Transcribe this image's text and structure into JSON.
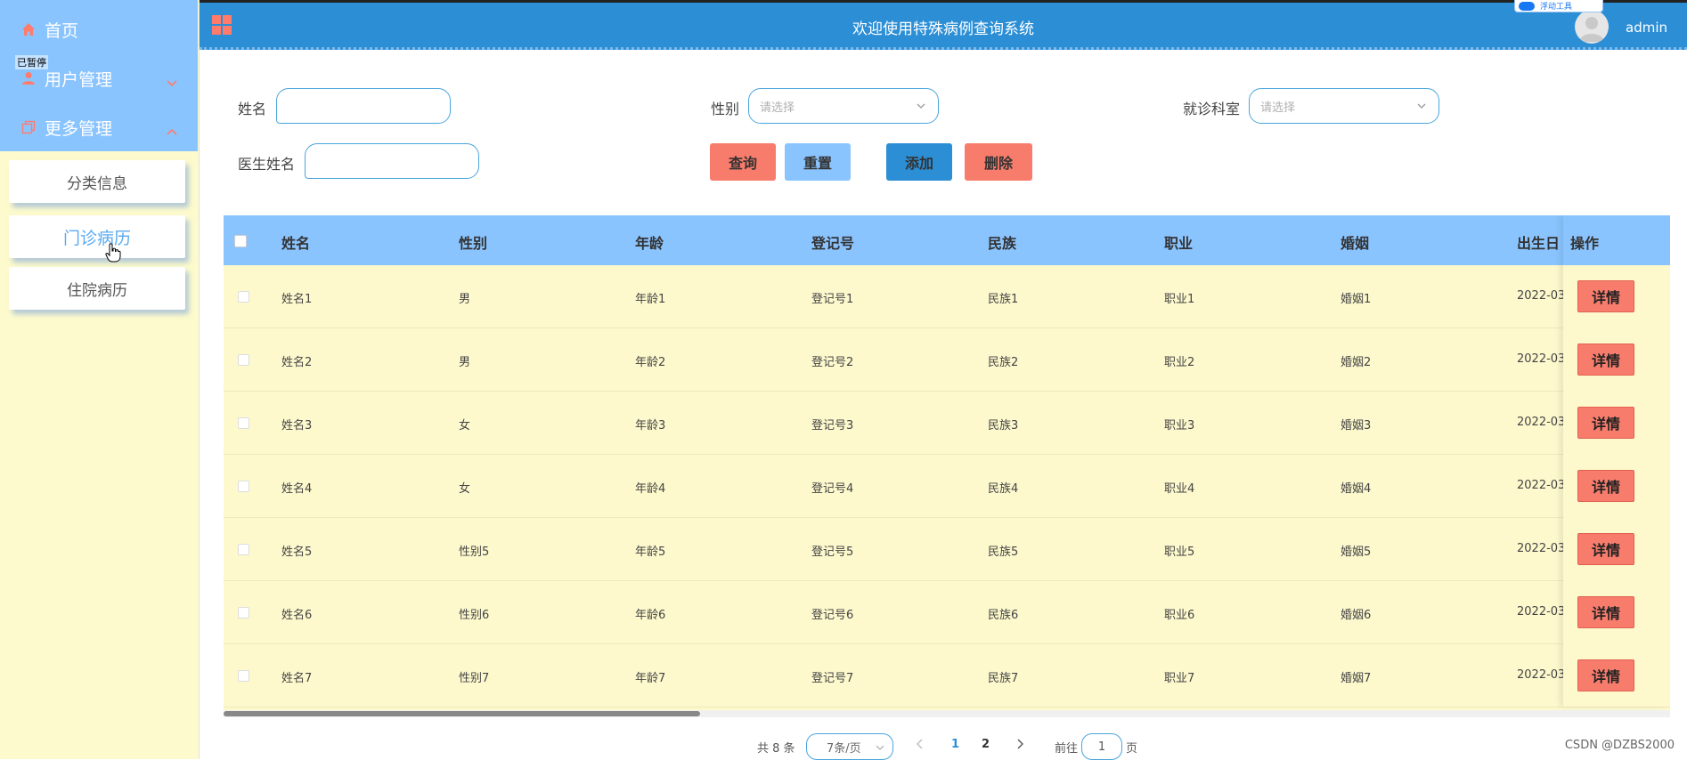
{
  "sidebar": {
    "items": [
      {
        "label": "首页",
        "icon": "home-icon"
      },
      {
        "label": "用户管理",
        "icon": "user-icon"
      },
      {
        "label": "更多管理",
        "icon": "copy-icon"
      }
    ],
    "paused_label": "已暂停",
    "sub_items": [
      {
        "label": "分类信息"
      },
      {
        "label": "门诊病历"
      },
      {
        "label": "住院病历"
      }
    ]
  },
  "header": {
    "title": "欢迎使用特殊病例查询系统",
    "user": "admin",
    "corner_badge": "浮动工具"
  },
  "search": {
    "name_label": "姓名",
    "name_value": "",
    "gender_label": "性别",
    "gender_placeholder": "请选择",
    "dept_label": "就诊科室",
    "dept_placeholder": "请选择",
    "doctor_label": "医生姓名",
    "doctor_value": "",
    "buttons": {
      "query": "查询",
      "reset": "重置",
      "add": "添加",
      "delete": "删除"
    }
  },
  "table": {
    "columns": [
      "姓名",
      "性别",
      "年龄",
      "登记号",
      "民族",
      "职业",
      "婚姻",
      "出生日",
      "操作"
    ],
    "rows": [
      [
        "姓名1",
        "男",
        "年龄1",
        "登记号1",
        "民族1",
        "职业1",
        "婚姻1",
        "2022-03-"
      ],
      [
        "姓名2",
        "男",
        "年龄2",
        "登记号2",
        "民族2",
        "职业2",
        "婚姻2",
        "2022-03-"
      ],
      [
        "姓名3",
        "女",
        "年龄3",
        "登记号3",
        "民族3",
        "职业3",
        "婚姻3",
        "2022-03-"
      ],
      [
        "姓名4",
        "女",
        "年龄4",
        "登记号4",
        "民族4",
        "职业4",
        "婚姻4",
        "2022-03-"
      ],
      [
        "姓名5",
        "性别5",
        "年龄5",
        "登记号5",
        "民族5",
        "职业5",
        "婚姻5",
        "2022-03-"
      ],
      [
        "姓名6",
        "性别6",
        "年龄6",
        "登记号6",
        "民族6",
        "职业6",
        "婚姻6",
        "2022-03-"
      ],
      [
        "姓名7",
        "性别7",
        "年龄7",
        "登记号7",
        "民族7",
        "职业7",
        "婚姻7",
        "2022-03-"
      ]
    ],
    "detail_label": "详情"
  },
  "pagination": {
    "total": "共 8 条",
    "page_size": "7条/页",
    "pages": [
      "1",
      "2"
    ],
    "current": "1",
    "goto_prefix": "前往",
    "goto_value": "1",
    "goto_suffix": "页"
  },
  "watermark": "CSDN @DZBS2000",
  "colors": {
    "header_bg": "#2c8fd6",
    "sidebar_top": "#8ac4ff",
    "sidebar_bg": "#fdfbcd",
    "table_head": "#8ac4ff",
    "row_bg": "#fdf9cd",
    "danger": "#f87c6c",
    "accent_icon": "#ff7b6b"
  }
}
